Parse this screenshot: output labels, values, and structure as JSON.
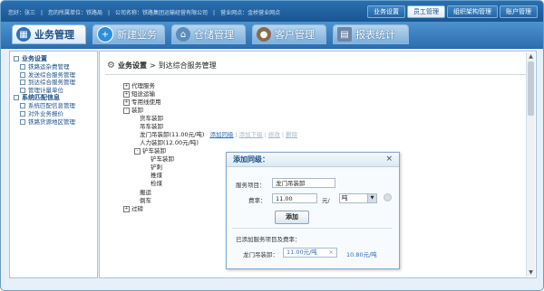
{
  "topbar": {
    "user_info": "您好：张三　|　您的所属单位：铁路局　|　公司名称：铁路集团运输经营有限公司　|　营业网点：金桥营业网点",
    "links": [
      {
        "label": "业务设置",
        "active": false
      },
      {
        "label": "员工管理",
        "active": true
      },
      {
        "label": "组织架构管理",
        "active": false
      },
      {
        "label": "账户管理",
        "active": false
      }
    ]
  },
  "nav": {
    "tabs": [
      {
        "label": "业务管理",
        "icon": "business-icon",
        "active": true
      },
      {
        "label": "新建业务",
        "icon": "plus-icon",
        "active": false
      },
      {
        "label": "仓储管理",
        "icon": "warehouse-icon",
        "active": false
      },
      {
        "label": "客户管理",
        "icon": "customers-icon",
        "active": false
      },
      {
        "label": "报表统计",
        "icon": "report-icon",
        "active": false
      }
    ]
  },
  "sidebar": {
    "groups": [
      {
        "label": "业务设置",
        "items": [
          "铁路运杂费管理",
          "发送综合服务管理",
          "到达综合服务管理",
          "管理计量单位"
        ]
      },
      {
        "label": "系统匹配信息",
        "items": [
          "系统匹配信息管理",
          "对外业务报价",
          "铁路货源地区管理"
        ]
      }
    ]
  },
  "breadcrumb": {
    "title": "业务设置",
    "separator": ">",
    "page": "到达综合服务管理"
  },
  "tree": {
    "nodes": [
      {
        "label": "代理服务",
        "toggle": "+"
      },
      {
        "label": "短途运输",
        "toggle": "+"
      },
      {
        "label": "专用线使用",
        "toggle": "+"
      },
      {
        "label": "装卸",
        "toggle": "-"
      },
      {
        "label": "货车装卸"
      },
      {
        "label": "吊车装卸"
      },
      {
        "label": "龙门吊装卸(11.00元/吨)"
      },
      {
        "label": "人力装卸(12.00元/吨)"
      },
      {
        "label": "铲车装卸",
        "toggle": "-"
      },
      {
        "label": "铲车装卸"
      },
      {
        "label": "铲刺"
      },
      {
        "label": "推煤"
      },
      {
        "label": "检煤"
      },
      {
        "label": "搬运"
      },
      {
        "label": "倒车"
      },
      {
        "label": "过磅",
        "toggle": "+"
      }
    ],
    "actions": [
      "添加同级",
      "添加下级",
      "修改",
      "删除"
    ]
  },
  "modal": {
    "title": "添加同级：",
    "close": "×",
    "service_label": "服务项目：",
    "service_value": "龙门吊装卸",
    "rate_label": "费率：",
    "rate_value": "11.00",
    "unit_text": "元/",
    "unit_option": "吨",
    "add_button": "添加",
    "added_label": "已添加服务项目及费率：",
    "added_items": [
      {
        "name": "龙门吊装卸：",
        "chip": "11.00元/吨",
        "remove": "×",
        "other": "10.80元/吨"
      }
    ]
  }
}
